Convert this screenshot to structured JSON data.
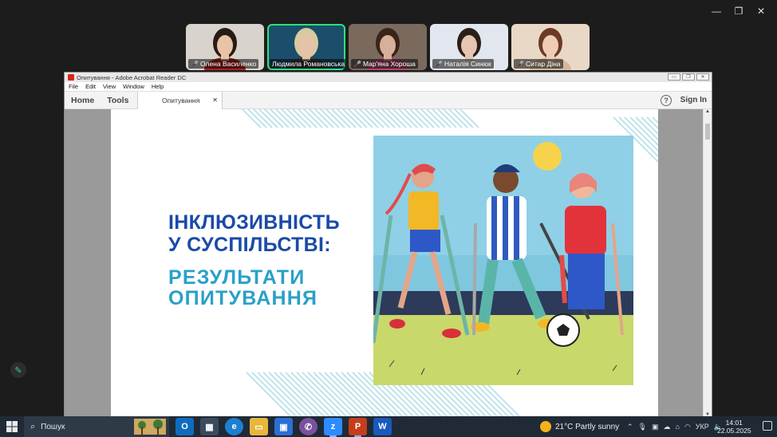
{
  "window_controls": [
    "—",
    "❐",
    "✕"
  ],
  "participants": [
    {
      "name": "Олена Василенко",
      "bg": "#d9d3cd",
      "skin": "#e8c3a8",
      "hair": "#2a1a14",
      "shirt": "#a8231f",
      "active": false
    },
    {
      "name": "Людмила Романовська",
      "bg": "#1b4e6b",
      "skin": "#e6c2a7",
      "hair": "#d8c9a0",
      "shirt": "#3a3a3a",
      "active": true
    },
    {
      "name": "Мар'яна Хороша",
      "bg": "#7a6a5e",
      "skin": "#d8b09a",
      "hair": "#3a2418",
      "shirt": "#b04a6a",
      "active": false
    },
    {
      "name": "Наталія Синюк",
      "bg": "#e2e6ee",
      "skin": "#e6c6b0",
      "hair": "#2a1f1a",
      "shirt": "#e8e8e8",
      "active": false
    },
    {
      "name": "Ситар Діна",
      "bg": "#e9d8c6",
      "skin": "#efcdb5",
      "hair": "#6b3b25",
      "shirt": "#d5b79c",
      "active": false
    }
  ],
  "acrobat": {
    "title": "Опитування - Adobe Acrobat Reader DC",
    "menu": [
      "File",
      "Edit",
      "View",
      "Window",
      "Help"
    ],
    "nav": [
      "Home",
      "Tools"
    ],
    "doc_tab": "Опитування",
    "help_icon": "?",
    "sign_in": "Sign In"
  },
  "slide": {
    "line1": "ІНКЛЮЗИВНІСТЬ",
    "line2": "У СУСПІЛЬСТВІ:",
    "line3": "РЕЗУЛЬТАТИ",
    "line4": "ОПИТУВАННЯ",
    "title_color": "#1a4aa8",
    "subtitle_color": "#2aa0c8",
    "stripe_color": "#bfe3ec"
  },
  "taskbar": {
    "search_label": "Пошук",
    "weather": "21°C  Partly sunny",
    "language": "УКР",
    "time": "14:01",
    "date": "22.05.2025"
  }
}
